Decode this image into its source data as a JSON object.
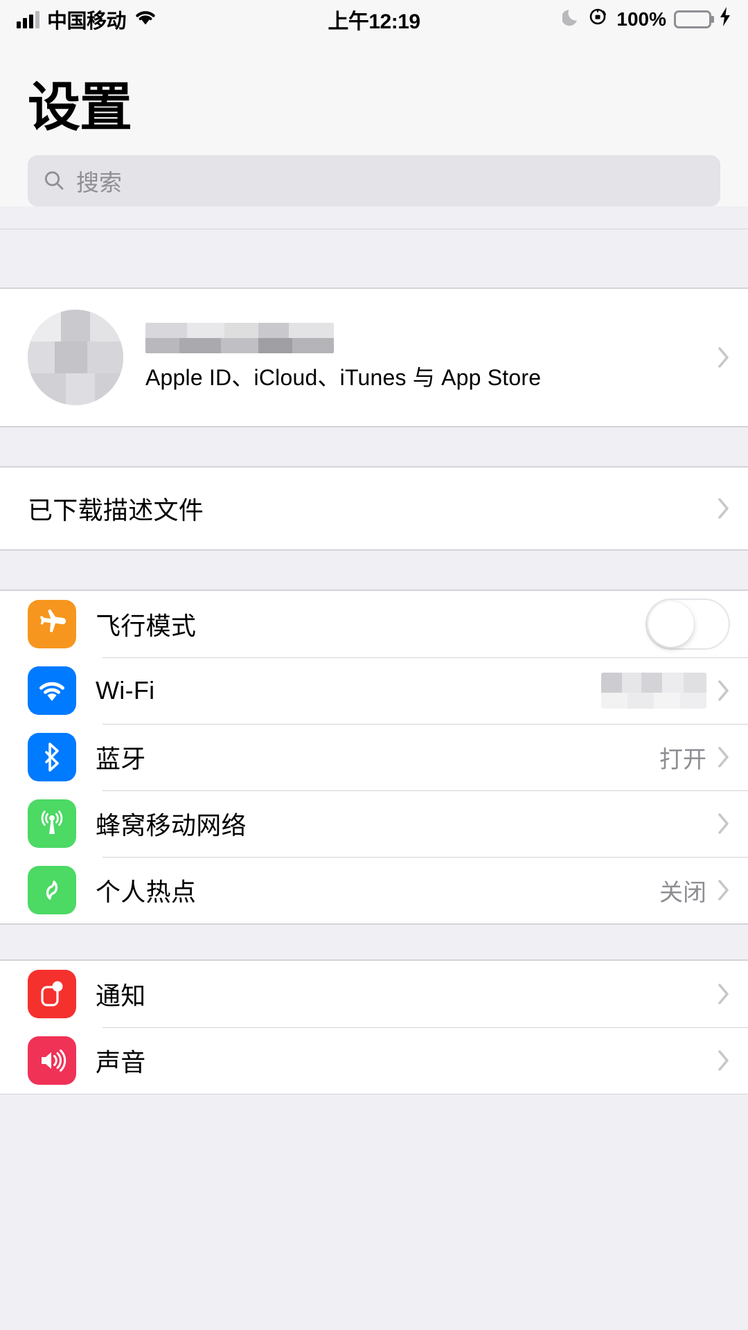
{
  "status_bar": {
    "signal_icon": "cellular-signal-icon",
    "carrier": "中国移动",
    "wifi_icon": "wifi-icon",
    "time": "上午12:19",
    "dnd_icon": "moon-do-not-disturb-icon",
    "rotation_lock_icon": "rotation-lock-icon",
    "battery_percent": "100%",
    "battery_icon": "battery-icon",
    "charging_icon": "lightning-bolt-charging-icon",
    "battery_color": "#4cd964"
  },
  "header": {
    "title": "设置",
    "search": {
      "icon": "search-icon",
      "placeholder": "搜索",
      "value": ""
    }
  },
  "account": {
    "avatar": "avatar-placeholder",
    "name": "",
    "name_redacted": true,
    "subtitle": "Apple ID、iCloud、iTunes 与 App Store",
    "chevron": "chevron-right-icon"
  },
  "profiles_group": {
    "rows": [
      {
        "label": "已下载描述文件",
        "value": "",
        "chevron": "chevron-right-icon"
      }
    ]
  },
  "network_group": {
    "rows": [
      {
        "label": "飞行模式",
        "icon": "airplane-icon",
        "icon_color": "#f6961e",
        "control": "toggle",
        "toggle_on": false
      },
      {
        "label": "Wi-Fi",
        "icon": "wifi-icon",
        "icon_color": "#007aff",
        "control": "value",
        "value": "",
        "value_redacted": true,
        "chevron": "chevron-right-icon"
      },
      {
        "label": "蓝牙",
        "icon": "bluetooth-icon",
        "icon_color": "#007aff",
        "control": "value",
        "value": "打开",
        "chevron": "chevron-right-icon"
      },
      {
        "label": "蜂窝移动网络",
        "icon": "cellular-antenna-icon",
        "icon_color": "#4cd964",
        "control": "value",
        "value": "",
        "chevron": "chevron-right-icon"
      },
      {
        "label": "个人热点",
        "icon": "personal-hotspot-icon",
        "icon_color": "#4cd964",
        "control": "value",
        "value": "关闭",
        "chevron": "chevron-right-icon"
      }
    ]
  },
  "alerts_group": {
    "rows": [
      {
        "label": "通知",
        "icon": "notifications-icon",
        "icon_color": "#f5312e",
        "control": "value",
        "value": "",
        "chevron": "chevron-right-icon"
      },
      {
        "label": "声音",
        "icon": "sounds-speaker-icon",
        "icon_color": "#f03257",
        "control": "value",
        "value": "",
        "chevron": "chevron-right-icon"
      }
    ]
  }
}
